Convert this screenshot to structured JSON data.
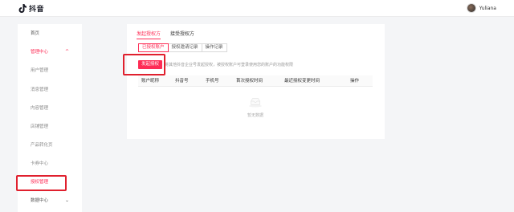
{
  "header": {
    "logo_text": "抖音",
    "user_name": "Yuliana"
  },
  "sidebar": {
    "items": [
      {
        "label": "首页"
      },
      {
        "label": "管理中心"
      },
      {
        "label": "用户管理"
      },
      {
        "label": "消息管理"
      },
      {
        "label": "内容管理"
      },
      {
        "label": "店铺管理"
      },
      {
        "label": "产品转化页"
      },
      {
        "label": "卡券中心"
      },
      {
        "label": "授权管理"
      },
      {
        "label": "数据中心"
      }
    ],
    "expand_glyph": "^",
    "collapse_glyph": "⌄"
  },
  "main": {
    "tabs": [
      {
        "label": "发起授权方"
      },
      {
        "label": "接受授权方"
      }
    ],
    "subtabs": [
      {
        "label": "已授权账户"
      },
      {
        "label": "授权邀请记录"
      },
      {
        "label": "操作记录"
      }
    ],
    "primary_button": "发起授权",
    "hint": "将其他抖音企业号发起授权，被授权账户可登录使用您的账户的功能权限",
    "table": {
      "columns": [
        "账户昵称",
        "抖音号",
        "手机号",
        "首次授权时间",
        "最近授权变更时间",
        "操作"
      ]
    },
    "empty_text": "暂无数据"
  },
  "colors": {
    "brand": "#fe2c55",
    "annotation": "#e0202e"
  }
}
